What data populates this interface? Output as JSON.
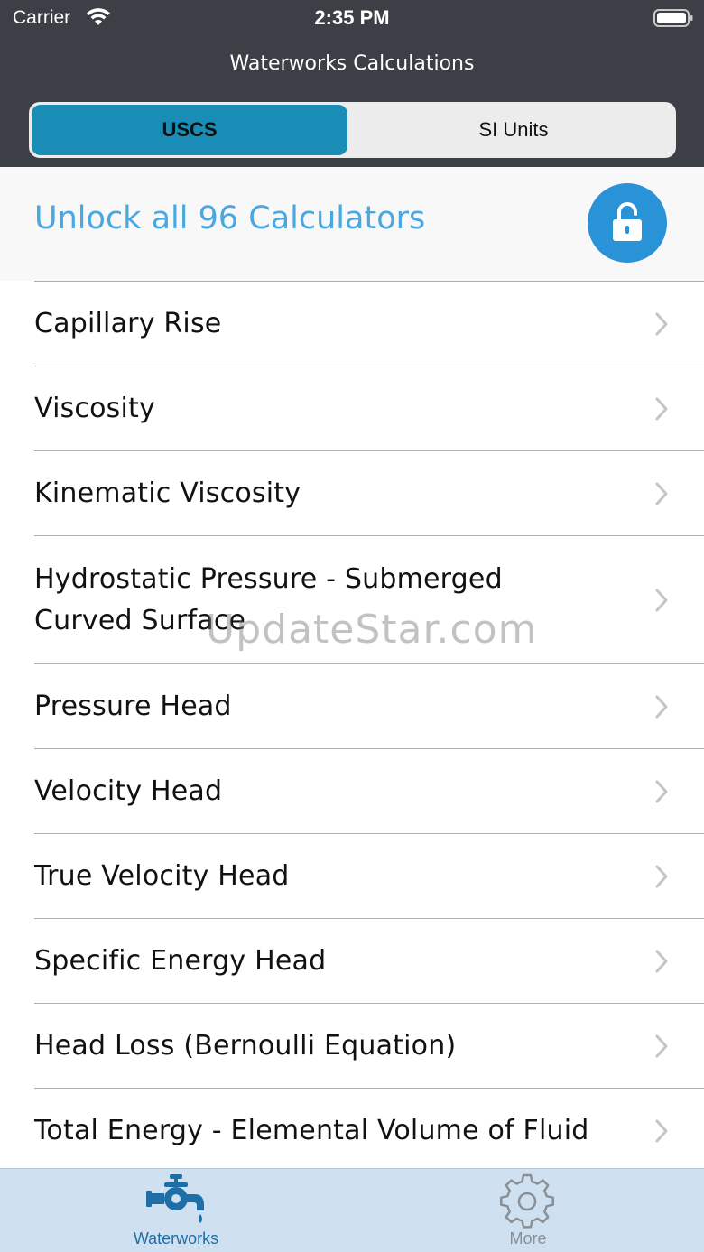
{
  "status_bar": {
    "carrier": "Carrier",
    "time": "2:35 PM"
  },
  "nav": {
    "title": "Waterworks Calculations"
  },
  "segmented_control": {
    "options": [
      "USCS",
      "SI Units"
    ],
    "selected": "USCS"
  },
  "unlock_banner": {
    "text": "Unlock all 96 Calculators",
    "icon": "unlock-icon"
  },
  "list": {
    "items": [
      {
        "label": "Capillary Rise"
      },
      {
        "label": "Viscosity"
      },
      {
        "label": "Kinematic Viscosity"
      },
      {
        "label": "Hydrostatic Pressure - Submerged Curved Surface"
      },
      {
        "label": "Pressure Head"
      },
      {
        "label": "Velocity Head"
      },
      {
        "label": "True Velocity Head"
      },
      {
        "label": "Specific Energy Head"
      },
      {
        "label": "Head Loss (Bernoulli Equation)"
      },
      {
        "label": "Total Energy - Elemental Volume of Fluid"
      }
    ]
  },
  "tabbar": {
    "tabs": [
      {
        "label": "Waterworks",
        "icon": "faucet-icon",
        "active": true
      },
      {
        "label": "More",
        "icon": "gear-icon",
        "active": false
      }
    ]
  },
  "watermark": "UpdateStar.com",
  "colors": {
    "header_bg": "#3d3f46",
    "segment_selected": "#1a8db6",
    "accent": "#4aa7df",
    "lock_button": "#2a92d6",
    "tabbar_bg": "#cfe0f0"
  }
}
